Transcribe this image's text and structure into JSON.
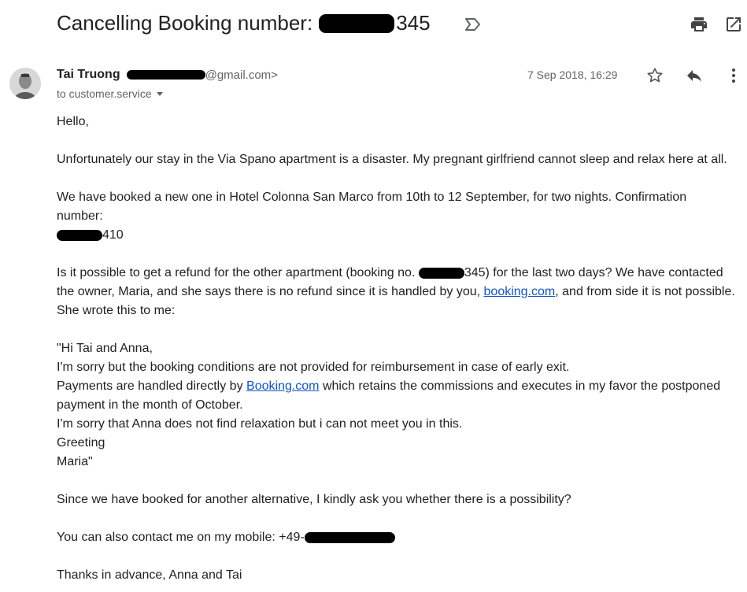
{
  "email": {
    "subject_prefix": "Cancelling Booking number: ",
    "subject_suffix": "345",
    "sender_name": "Tai Truong",
    "sender_email_suffix": "@gmail.com>",
    "to_label": "to customer.service",
    "date": "7 Sep 2018, 16:29"
  },
  "icons": {
    "label": "label-important-icon",
    "print": "print-icon",
    "popout": "open-in-new-window-icon",
    "star": "star-icon",
    "reply": "reply-icon",
    "more": "more-vert-icon"
  },
  "body": {
    "greeting": "Hello,",
    "p1": "Unfortunately our stay in the Via Spano apartment is a disaster. My pregnant girlfriend cannot sleep and relax here at all.",
    "p2_line1": "We have booked a new one in Hotel Colonna San Marco from 10th to 12 September, for two nights. Confirmation",
    "p2_line2": "number:",
    "confirmation_suffix": "410",
    "p3_a": "Is it possible to get a refund for the other apartment (booking no. ",
    "p3_b": "345) for the last two days? We have contacted the owner, Maria, and she says there is no refund since it is handled by you, ",
    "p3_link": "booking.com",
    "p3_c": ", and from side it is not possible. She wrote this to me:",
    "q1": "\"Hi Tai and Anna,",
    "q2": "I'm sorry but the booking conditions are not provided for reimbursement in case of early exit.",
    "q3_a": "Payments are handled directly by ",
    "q3_link": "Booking.com",
    "q3_b": " which retains the commissions and executes in my favor the postponed payment in the month of October.",
    "q4": "I'm sorry that Anna does not find relaxation but i can not meet you in this.",
    "q5": "Greeting",
    "q6": "Maria\"",
    "p4": "Since we have booked for another alternative, I kindly ask you whether there is a possibility?",
    "p5_a": "You can also contact me on my mobile: +49-",
    "closing": "Thanks in advance, Anna and Tai"
  }
}
